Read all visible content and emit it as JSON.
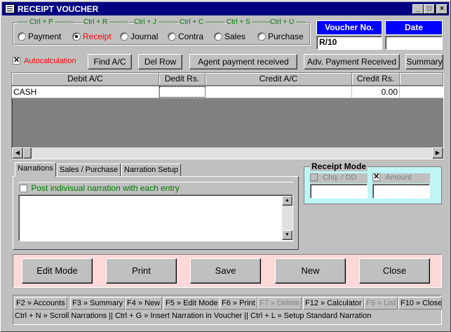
{
  "window": {
    "title": "RECEIPT VOUCHER",
    "controls": {
      "minimize": "_",
      "maximize": "□",
      "close": "×"
    }
  },
  "voucher_type": {
    "options": [
      {
        "shortcut": "Ctrl + P",
        "label": "Payment",
        "selected": false
      },
      {
        "shortcut": "Ctrl + R",
        "label": "Receipt",
        "selected": true
      },
      {
        "shortcut": "Ctrl + J",
        "label": "Journal",
        "selected": false
      },
      {
        "shortcut": "Ctrl + C",
        "label": "Contra",
        "selected": false
      },
      {
        "shortcut": "Ctrl + S",
        "label": "Sales",
        "selected": false
      },
      {
        "shortcut": "Ctrl + U",
        "label": "Purchase",
        "selected": false
      }
    ]
  },
  "voucher_no": {
    "label": "Voucher No.",
    "value": "R/10"
  },
  "date": {
    "label": "Date",
    "value": ""
  },
  "toolbar": {
    "autocalc_label": "Autocalculation",
    "autocalc_checked": true,
    "find_ac": "Find A/C",
    "del_row": "Del Row",
    "agent_payment": "Agent payment received",
    "adv_payment": "Adv. Payment Received",
    "summary": "Summary"
  },
  "grid": {
    "columns": [
      "Debit A/C",
      "Dedit Rs.",
      "Credit A/C",
      "Credit Rs."
    ],
    "rows": [
      {
        "debit_ac": "CASH",
        "debit_rs": "",
        "credit_ac": "",
        "credit_rs": "0.00"
      }
    ]
  },
  "tabs": [
    {
      "label": "Narrations",
      "active": true
    },
    {
      "label": "Sales / Purchase",
      "active": false
    },
    {
      "label": "Narration Setup",
      "active": false
    }
  ],
  "narration": {
    "post_label": "Post indivisual narration with each entry",
    "post_checked": false,
    "text": ""
  },
  "receipt_mode": {
    "title": "Receipt Mode",
    "chq_label": "Chq. / DD",
    "chq_checked": false,
    "chq_value": "",
    "amount_label": "Amount",
    "amount_checked": true,
    "amount_value": ""
  },
  "actions": {
    "edit_mode": "Edit Mode",
    "print": "Print",
    "save": "Save",
    "new": "New",
    "close": "Close"
  },
  "function_keys": [
    {
      "label": "F2 » Accounts",
      "enabled": true
    },
    {
      "label": "F3 » Summary",
      "enabled": true
    },
    {
      "label": "F4 » New",
      "enabled": true
    },
    {
      "label": "F5 » Edit Mode",
      "enabled": true
    },
    {
      "label": "F6 » Print",
      "enabled": true
    },
    {
      "label": "F7 » Delete",
      "enabled": false
    },
    {
      "label": "F12 » Calculator",
      "enabled": true
    },
    {
      "label": "F9 » List",
      "enabled": false
    },
    {
      "label": "F10 » Close",
      "enabled": true
    }
  ],
  "status_hint": "Ctrl + N » Scroll Narrations || Ctrl + G » Insert Narration in Voucher || Ctrl + L » Setup Standard Narration",
  "colors": {
    "title_bar": "#000080",
    "voucher_header": "#0000ff",
    "shortcut_text": "#007a00",
    "autocalc_text": "#ff0000",
    "action_panel": "#ffd8d8",
    "receipt_mode_panel": "#bff5f5"
  }
}
